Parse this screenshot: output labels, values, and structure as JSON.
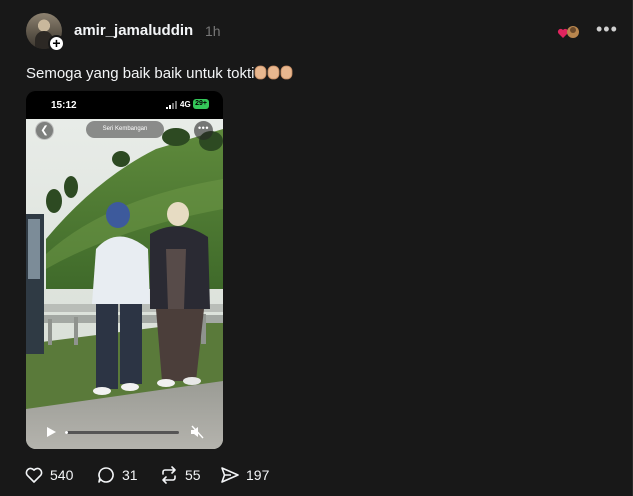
{
  "post": {
    "username": "amir_jamaluddin",
    "time": "1h",
    "caption": "Semoga yang baik baik untuk tokti",
    "caption_emoji": "clapping-hands-x3",
    "avatar_badge": "+"
  },
  "media": {
    "status_time": "15:12",
    "network": "4G",
    "battery": "29+",
    "location_label": "Seri Kembangan",
    "progress": 0.03
  },
  "actions": {
    "likes": "540",
    "replies": "31",
    "reposts": "55",
    "shares": "197"
  },
  "icons": [
    "heart-icon",
    "comment-icon",
    "repost-icon",
    "share-icon",
    "more-icon",
    "play-icon",
    "mute-icon"
  ],
  "colors": {
    "background": "#181818",
    "text": "#f3f5f7",
    "muted": "#777777",
    "battery": "#34c759"
  }
}
